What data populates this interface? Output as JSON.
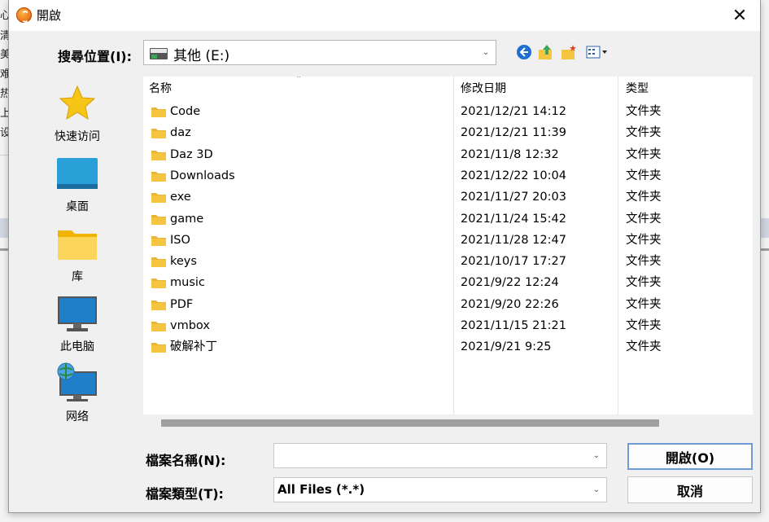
{
  "background_app": {
    "side_chars": [
      "心",
      "清",
      "美",
      "难",
      "热",
      "上",
      "设"
    ]
  },
  "dialog": {
    "title": "開啟",
    "close_symbol": "✕"
  },
  "lookin": {
    "label": "搜尋位置(I):",
    "value": "其他 (E:)",
    "icon": "drive-icon"
  },
  "toolbar": {
    "icons": [
      "back-icon",
      "up-folder-icon",
      "new-folder-icon",
      "view-menu-icon"
    ]
  },
  "places": [
    {
      "label": "快速访问",
      "icon": "star-icon"
    },
    {
      "label": "桌面",
      "icon": "desktop-icon"
    },
    {
      "label": "库",
      "icon": "library-folder-icon"
    },
    {
      "label": "此电脑",
      "icon": "monitor-icon"
    },
    {
      "label": "网络",
      "icon": "network-icon"
    }
  ],
  "file_list": {
    "columns": [
      "名称",
      "修改日期",
      "类型"
    ],
    "rows": [
      {
        "name": "Code",
        "date": "2021/12/21 14:12",
        "type": "文件夹"
      },
      {
        "name": "daz",
        "date": "2021/12/21 11:39",
        "type": "文件夹"
      },
      {
        "name": "Daz 3D",
        "date": "2021/11/8 12:32",
        "type": "文件夹"
      },
      {
        "name": "Downloads",
        "date": "2021/12/22 10:04",
        "type": "文件夹"
      },
      {
        "name": "exe",
        "date": "2021/11/27 20:03",
        "type": "文件夹"
      },
      {
        "name": "game",
        "date": "2021/11/24 15:42",
        "type": "文件夹"
      },
      {
        "name": "ISO",
        "date": "2021/11/28 12:47",
        "type": "文件夹"
      },
      {
        "name": "keys",
        "date": "2021/10/17 17:27",
        "type": "文件夹"
      },
      {
        "name": "music",
        "date": "2021/9/22 12:24",
        "type": "文件夹"
      },
      {
        "name": "PDF",
        "date": "2021/9/20 22:26",
        "type": "文件夹"
      },
      {
        "name": "vmbox",
        "date": "2021/11/15 21:21",
        "type": "文件夹"
      },
      {
        "name": "破解补丁",
        "date": "2021/9/21 9:25",
        "type": "文件夹"
      }
    ]
  },
  "filename": {
    "label": "檔案名稱(N):",
    "value": ""
  },
  "filetype": {
    "label": "檔案類型(T):",
    "value": "All Files (*.*)"
  },
  "buttons": {
    "open": "開啟(O)",
    "cancel": "取消"
  },
  "colors": {
    "folder": "#f5c542",
    "accent": "#6e9bd8"
  }
}
